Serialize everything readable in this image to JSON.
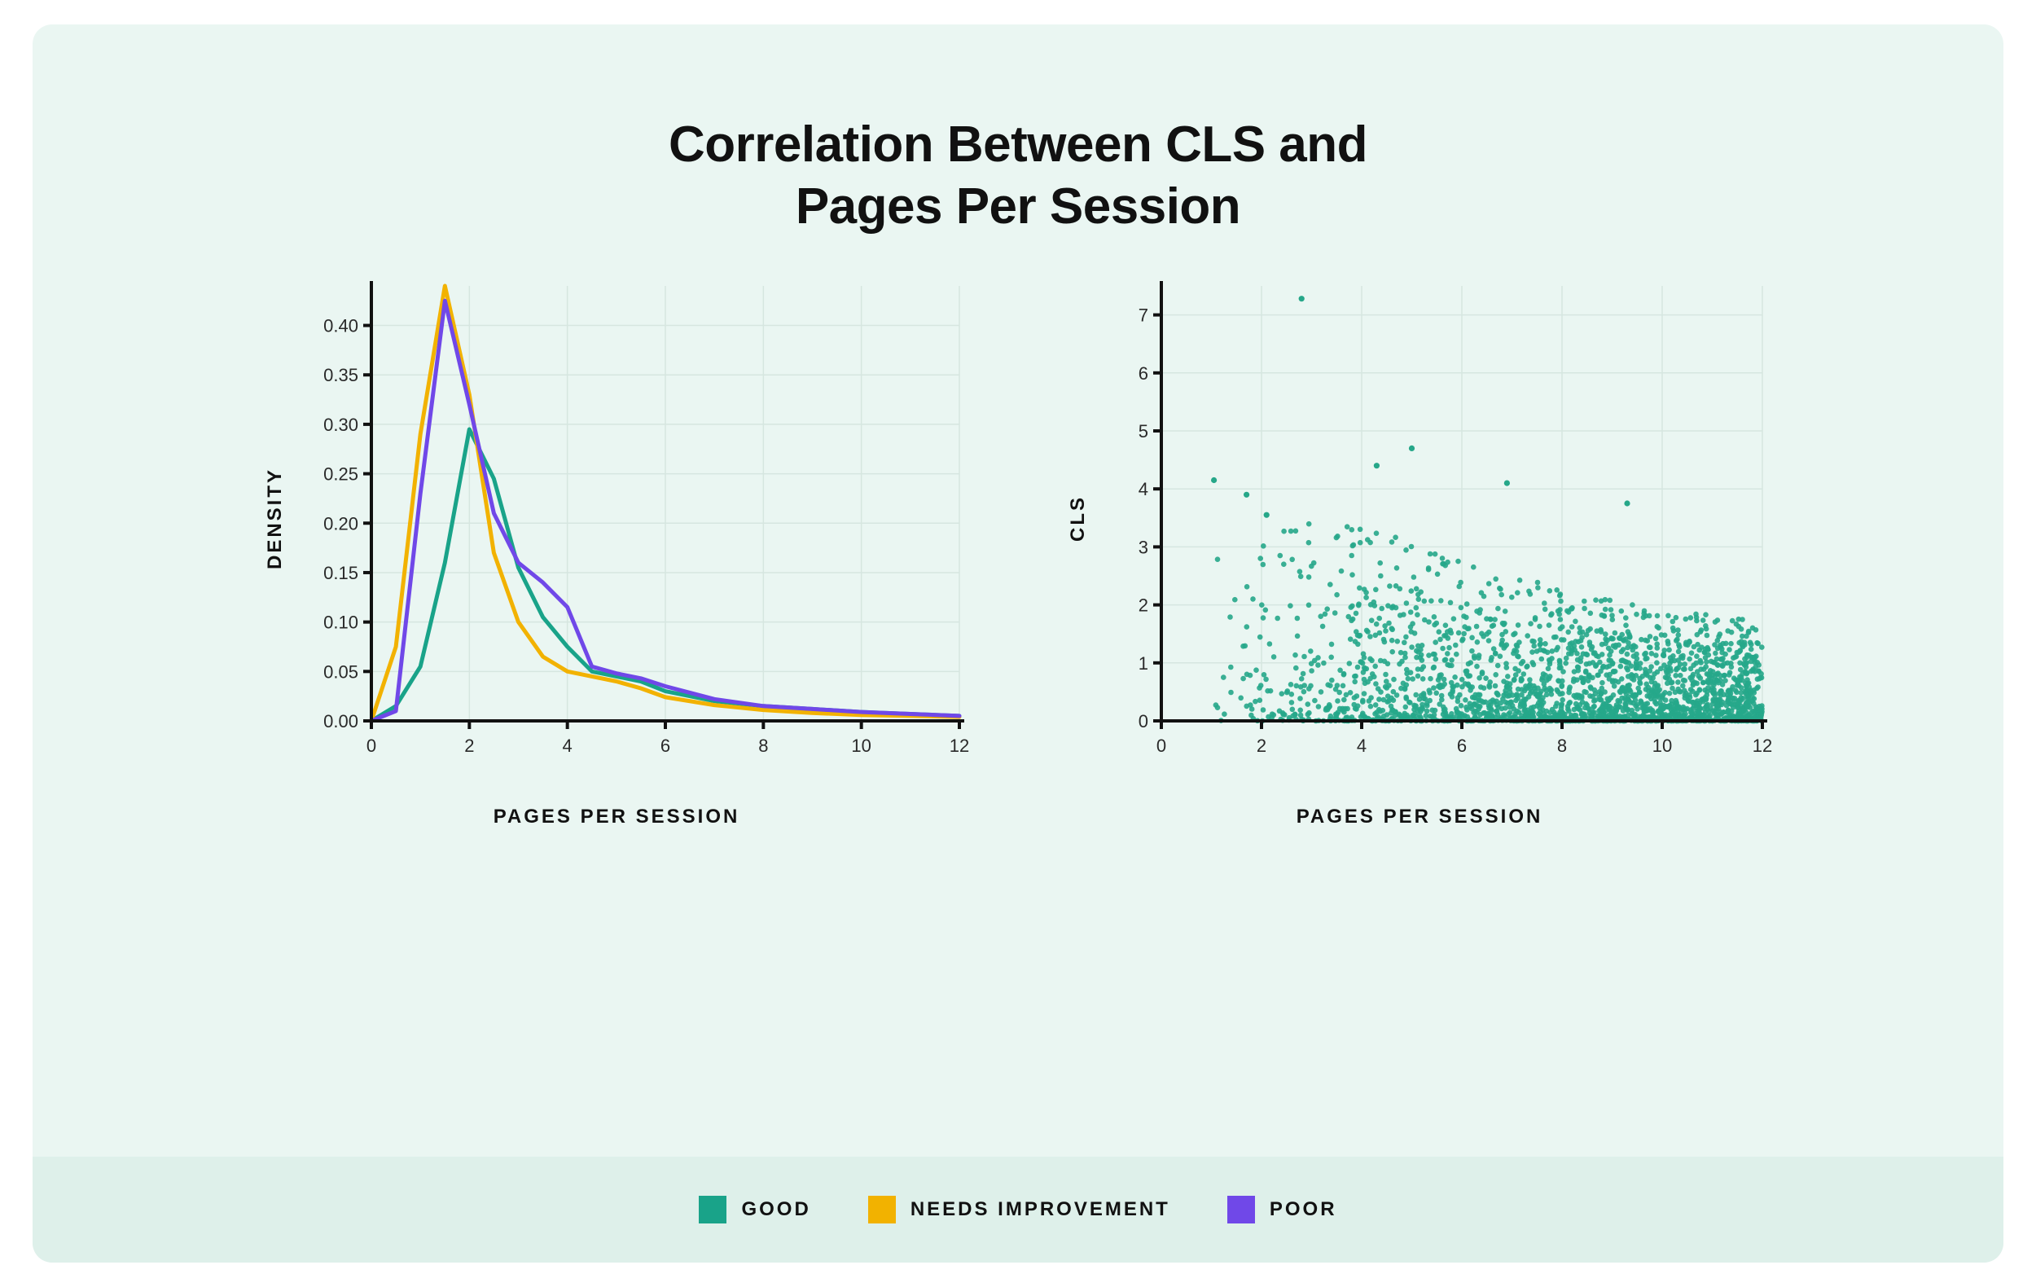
{
  "title_line1": "Correlation Between CLS and",
  "title_line2": "Pages Per Session",
  "colors": {
    "good": "#19a389",
    "needs_improvement": "#f2b200",
    "poor": "#7048e8",
    "grid": "#d6e6e0",
    "axis": "#111111",
    "scatter": "#26a789"
  },
  "legend": [
    {
      "key": "good",
      "label": "GOOD"
    },
    {
      "key": "needs_improvement",
      "label": "NEEDS IMPROVEMENT"
    },
    {
      "key": "poor",
      "label": "POOR"
    }
  ],
  "chart_data": [
    {
      "type": "line",
      "id": "density_plot",
      "title": "",
      "xlabel": "PAGES PER SESSION",
      "ylabel": "DENSITY",
      "xlim": [
        0,
        12
      ],
      "ylim": [
        0,
        0.44
      ],
      "x_ticks": [
        0,
        2,
        4,
        6,
        8,
        10,
        12
      ],
      "y_ticks": [
        0.0,
        0.05,
        0.1,
        0.15,
        0.2,
        0.25,
        0.3,
        0.35,
        0.4
      ],
      "y_tick_labels": [
        "0.00",
        "0.05",
        "0.10",
        "0.15",
        "0.20",
        "0.25",
        "0.30",
        "0.35",
        "0.40"
      ],
      "x": [
        0,
        0.5,
        1,
        1.5,
        2,
        2.5,
        3,
        3.5,
        4,
        4.5,
        5,
        5.5,
        6,
        7,
        8,
        9,
        10,
        11,
        12
      ],
      "series": [
        {
          "name": "GOOD",
          "color_key": "good",
          "values": [
            0.0,
            0.015,
            0.055,
            0.16,
            0.295,
            0.245,
            0.155,
            0.105,
            0.075,
            0.05,
            0.045,
            0.04,
            0.03,
            0.02,
            0.015,
            0.012,
            0.009,
            0.007,
            0.005
          ]
        },
        {
          "name": "NEEDS IMPROVEMENT",
          "color_key": "needs_improvement",
          "values": [
            0.0,
            0.075,
            0.29,
            0.44,
            0.33,
            0.17,
            0.1,
            0.065,
            0.05,
            0.045,
            0.04,
            0.033,
            0.024,
            0.016,
            0.011,
            0.008,
            0.006,
            0.005,
            0.004
          ]
        },
        {
          "name": "POOR",
          "color_key": "poor",
          "values": [
            0.0,
            0.01,
            0.23,
            0.425,
            0.32,
            0.21,
            0.16,
            0.14,
            0.115,
            0.055,
            0.048,
            0.043,
            0.035,
            0.022,
            0.015,
            0.012,
            0.009,
            0.007,
            0.005
          ]
        }
      ]
    },
    {
      "type": "scatter",
      "id": "scatter_plot",
      "title": "",
      "xlabel": "PAGES PER SESSION",
      "ylabel": "CLS",
      "xlim": [
        0,
        12
      ],
      "ylim": [
        0,
        7.5
      ],
      "x_ticks": [
        0,
        2,
        4,
        6,
        8,
        10,
        12
      ],
      "y_ticks": [
        0,
        1,
        2,
        3,
        4,
        5,
        6,
        7
      ],
      "outliers": [
        {
          "x": 2.8,
          "y": 7.28
        },
        {
          "x": 1.05,
          "y": 4.15
        },
        {
          "x": 4.3,
          "y": 4.4
        },
        {
          "x": 5.0,
          "y": 4.7
        },
        {
          "x": 6.9,
          "y": 4.1
        },
        {
          "x": 9.3,
          "y": 3.75
        },
        {
          "x": 1.7,
          "y": 3.9
        },
        {
          "x": 2.1,
          "y": 3.55
        }
      ],
      "dense_region": {
        "x_start": 1.0,
        "x_end": 12.0,
        "seed": 12345,
        "count": 2400,
        "envelope": [
          {
            "x": 1.0,
            "top": 3.3
          },
          {
            "x": 2.0,
            "top": 3.0
          },
          {
            "x": 3.0,
            "top": 2.7
          },
          {
            "x": 4.0,
            "top": 2.5
          },
          {
            "x": 5.0,
            "top": 2.3
          },
          {
            "x": 6.0,
            "top": 2.05
          },
          {
            "x": 7.0,
            "top": 1.85
          },
          {
            "x": 8.0,
            "top": 1.7
          },
          {
            "x": 9.0,
            "top": 1.55
          },
          {
            "x": 10.0,
            "top": 1.4
          },
          {
            "x": 11.0,
            "top": 1.35
          },
          {
            "x": 12.0,
            "top": 1.3
          }
        ]
      }
    }
  ]
}
